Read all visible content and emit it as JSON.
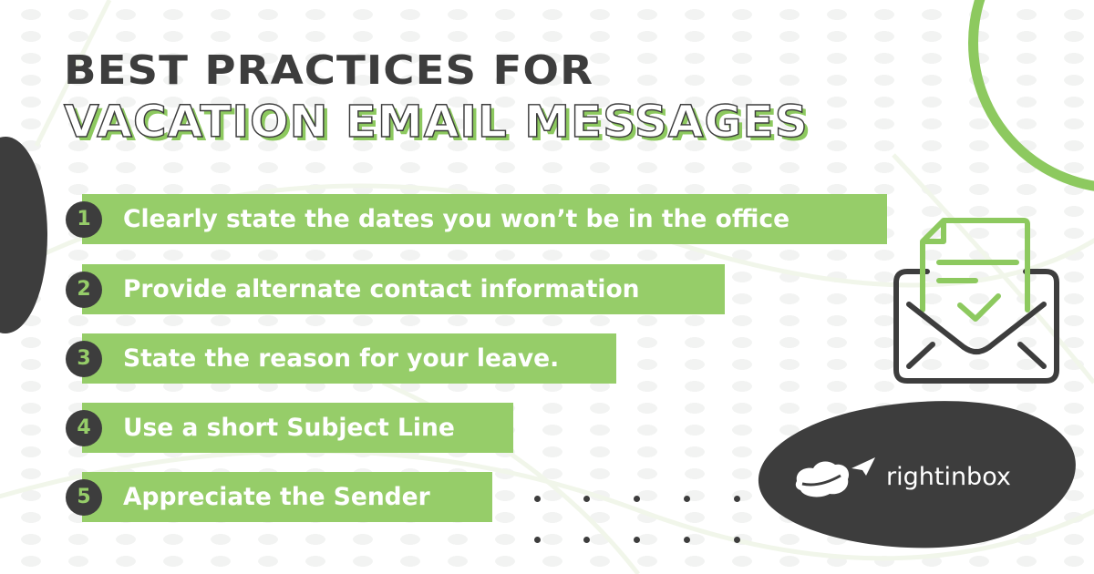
{
  "header": {
    "title_line_1": "BEST PRACTICES FOR",
    "title_line_2": "VACATION EMAIL MESSAGES"
  },
  "practices": [
    {
      "number": "1",
      "text": "Clearly state the dates you won’t be in the office"
    },
    {
      "number": "2",
      "text": "Provide alternate contact information"
    },
    {
      "number": "3",
      "text": "State the reason for your leave."
    },
    {
      "number": "4",
      "text": "Use a short Subject Line"
    },
    {
      "number": "5",
      "text": "Appreciate the Sender"
    }
  ],
  "illustration": {
    "icon": "envelope-with-checked-document-icon"
  },
  "brand": {
    "name": "rightinbox",
    "logo_icon": "cloud-paper-plane-icon"
  },
  "colors": {
    "accent_green": "#96cd69",
    "ring_green": "#8dc95f",
    "dark": "#3d3d3d",
    "background": "#ffffff"
  }
}
